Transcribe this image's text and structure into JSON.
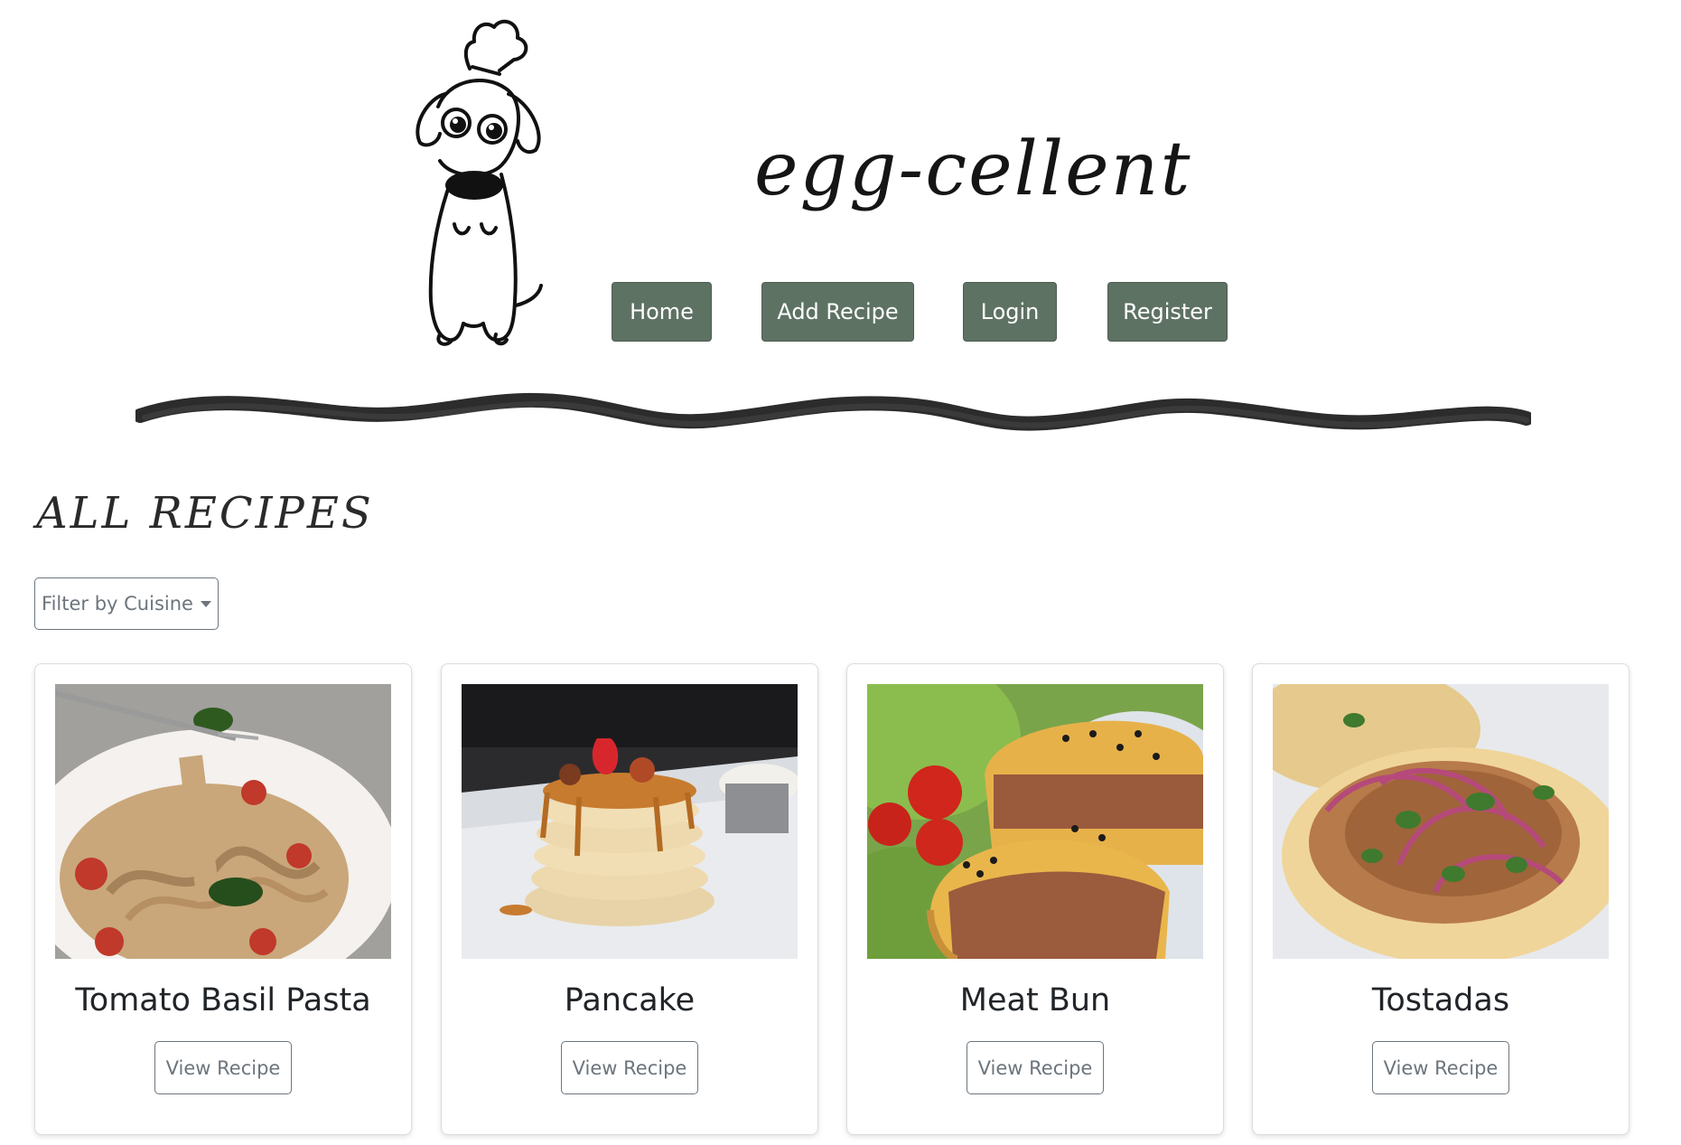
{
  "header": {
    "brand": "egg-cellent",
    "nav": [
      {
        "label": "Home",
        "icon": "home"
      },
      {
        "label": "Add Recipe",
        "icon": "add"
      },
      {
        "label": "Login",
        "icon": "login"
      },
      {
        "label": "Register",
        "icon": "register"
      }
    ],
    "logo_icon": "chef-dog-icon"
  },
  "main": {
    "section_title": "ALL RECIPES",
    "filter_label": "Filter by Cuisine",
    "recipes": [
      {
        "title": "Tomato Basil Pasta",
        "button": "View Recipe",
        "image": "pasta-photo"
      },
      {
        "title": "Pancake",
        "button": "View Recipe",
        "image": "pancake-photo"
      },
      {
        "title": "Meat Bun",
        "button": "View Recipe",
        "image": "meat-bun-photo"
      },
      {
        "title": "Tostadas",
        "button": "View Recipe",
        "image": "tostadas-photo"
      }
    ]
  },
  "colors": {
    "nav_button": "#5e7264",
    "outline": "#6c757d",
    "text": "#212529"
  }
}
